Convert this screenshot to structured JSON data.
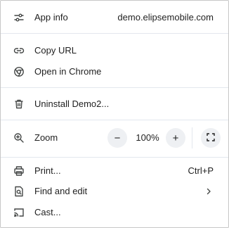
{
  "header": {
    "app_info_label": "App info",
    "domain": "demo.elipsemobile.com",
    "icon": "sliders-icon"
  },
  "links": {
    "copy_url_label": "Copy URL",
    "open_in_chrome_label": "Open in Chrome",
    "icons": [
      "link-icon",
      "chrome-icon"
    ]
  },
  "uninstall": {
    "label": "Uninstall Demo2...",
    "icon": "trash-icon"
  },
  "zoom": {
    "label": "Zoom",
    "minus_label": "−",
    "value": "100%",
    "plus_label": "+",
    "icons": [
      "zoom-icon",
      "fullscreen-icon"
    ]
  },
  "actions": {
    "print_label": "Print...",
    "print_shortcut": "Ctrl+P",
    "find_edit_label": "Find and edit",
    "cast_label": "Cast...",
    "icons": [
      "printer-icon",
      "find-page-icon",
      "cast-icon",
      "chevron-right-icon"
    ]
  },
  "colors": {
    "text": "#1f1f1f",
    "icon": "#444746",
    "separator": "#e3e7ee",
    "zoom_button_bg": "#eef0f3",
    "border": "#c7c7c7"
  }
}
